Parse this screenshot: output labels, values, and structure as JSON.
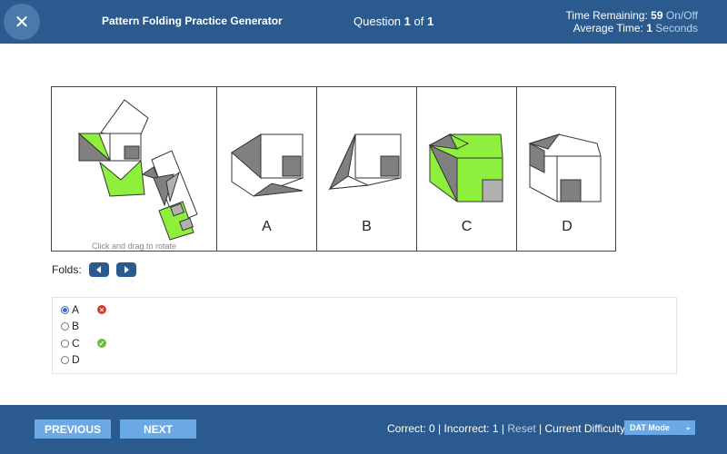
{
  "header": {
    "close_glyph": "✕",
    "title": "Pattern Folding Practice Generator",
    "question_prefix": "Question",
    "question_current": "1",
    "question_of": "of",
    "question_total": "1",
    "time_remaining_label": "Time Remaining:",
    "time_remaining_value": "59",
    "toggle_label": "On/Off",
    "average_label": "Average Time:",
    "average_value": "1",
    "average_unit": "Seconds"
  },
  "figure": {
    "rotate_hint": "Click and drag to rotate",
    "options": [
      "A",
      "B",
      "C",
      "D"
    ]
  },
  "folds": {
    "label": "Folds:"
  },
  "answers": [
    {
      "label": "A",
      "selected": true,
      "mark": "wrong"
    },
    {
      "label": "B",
      "selected": false,
      "mark": ""
    },
    {
      "label": "C",
      "selected": false,
      "mark": "correct"
    },
    {
      "label": "D",
      "selected": false,
      "mark": ""
    }
  ],
  "footer": {
    "previous_label": "PREVIOUS",
    "next_label": "NEXT",
    "correct_label": "Correct:",
    "correct_value": "0",
    "incorrect_label": "Incorrect:",
    "incorrect_value": "1",
    "reset_label": "Reset",
    "difficulty_label": "Current Difficulty:",
    "difficulty_value": "DAT Mode"
  },
  "colors": {
    "bar": "#2b5a8e",
    "button": "#6aa8e6",
    "shape_green": "#8ef03c",
    "shape_dark_gray": "#808080",
    "shape_light_gray": "#b0b0b0"
  }
}
